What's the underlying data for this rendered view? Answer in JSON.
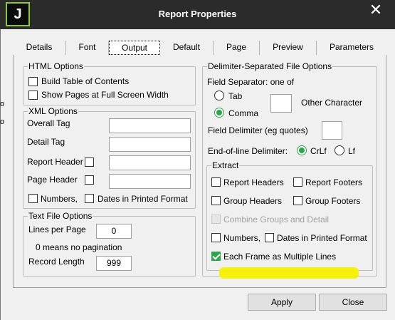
{
  "window": {
    "title": "Report Properties",
    "app_icon": "J",
    "close_glyph": "✕"
  },
  "edge_text": [
    "o",
    "o"
  ],
  "tabs": [
    "Details",
    "Font",
    "Output",
    "Default",
    "Page",
    "Preview",
    "Parameters"
  ],
  "html_options": {
    "legend": "HTML Options",
    "build_toc": "Build Table of Contents",
    "show_pages": "Show Pages at Full Screen Width"
  },
  "xml_options": {
    "legend": "XML Options",
    "overall_tag": "Overall Tag",
    "detail_tag": "Detail Tag",
    "report_header": "Report Header",
    "page_header": "Page Header",
    "numbers": "Numbers,",
    "dates": "Dates in Printed Format"
  },
  "text_file": {
    "legend": "Text File Options",
    "lines_per_page": "Lines per Page",
    "lines_value": "0",
    "no_pagination": "0 means no pagination",
    "record_length": "Record Length",
    "record_value": "999"
  },
  "delimited": {
    "legend": "Delimiter-Separated File Options",
    "field_sep": "Field Separator: one of",
    "tab": "Tab",
    "comma": "Comma",
    "other_char": "Other Character",
    "field_delim": "Field Delimiter (eg quotes)",
    "eol": "End-of-line Delimiter:",
    "crlf": "CrLf",
    "lf": "Lf"
  },
  "extract": {
    "legend": "Extract",
    "report_headers": "Report Headers",
    "report_footers": "Report Footers",
    "group_headers": "Group Headers",
    "group_footers": "Group Footers",
    "combine": "Combine Groups and Detail",
    "numbers": "Numbers,",
    "dates": "Dates in Printed Format",
    "each_frame": "Each Frame as Multiple Lines"
  },
  "buttons": {
    "apply": "Apply",
    "close": "Close"
  }
}
